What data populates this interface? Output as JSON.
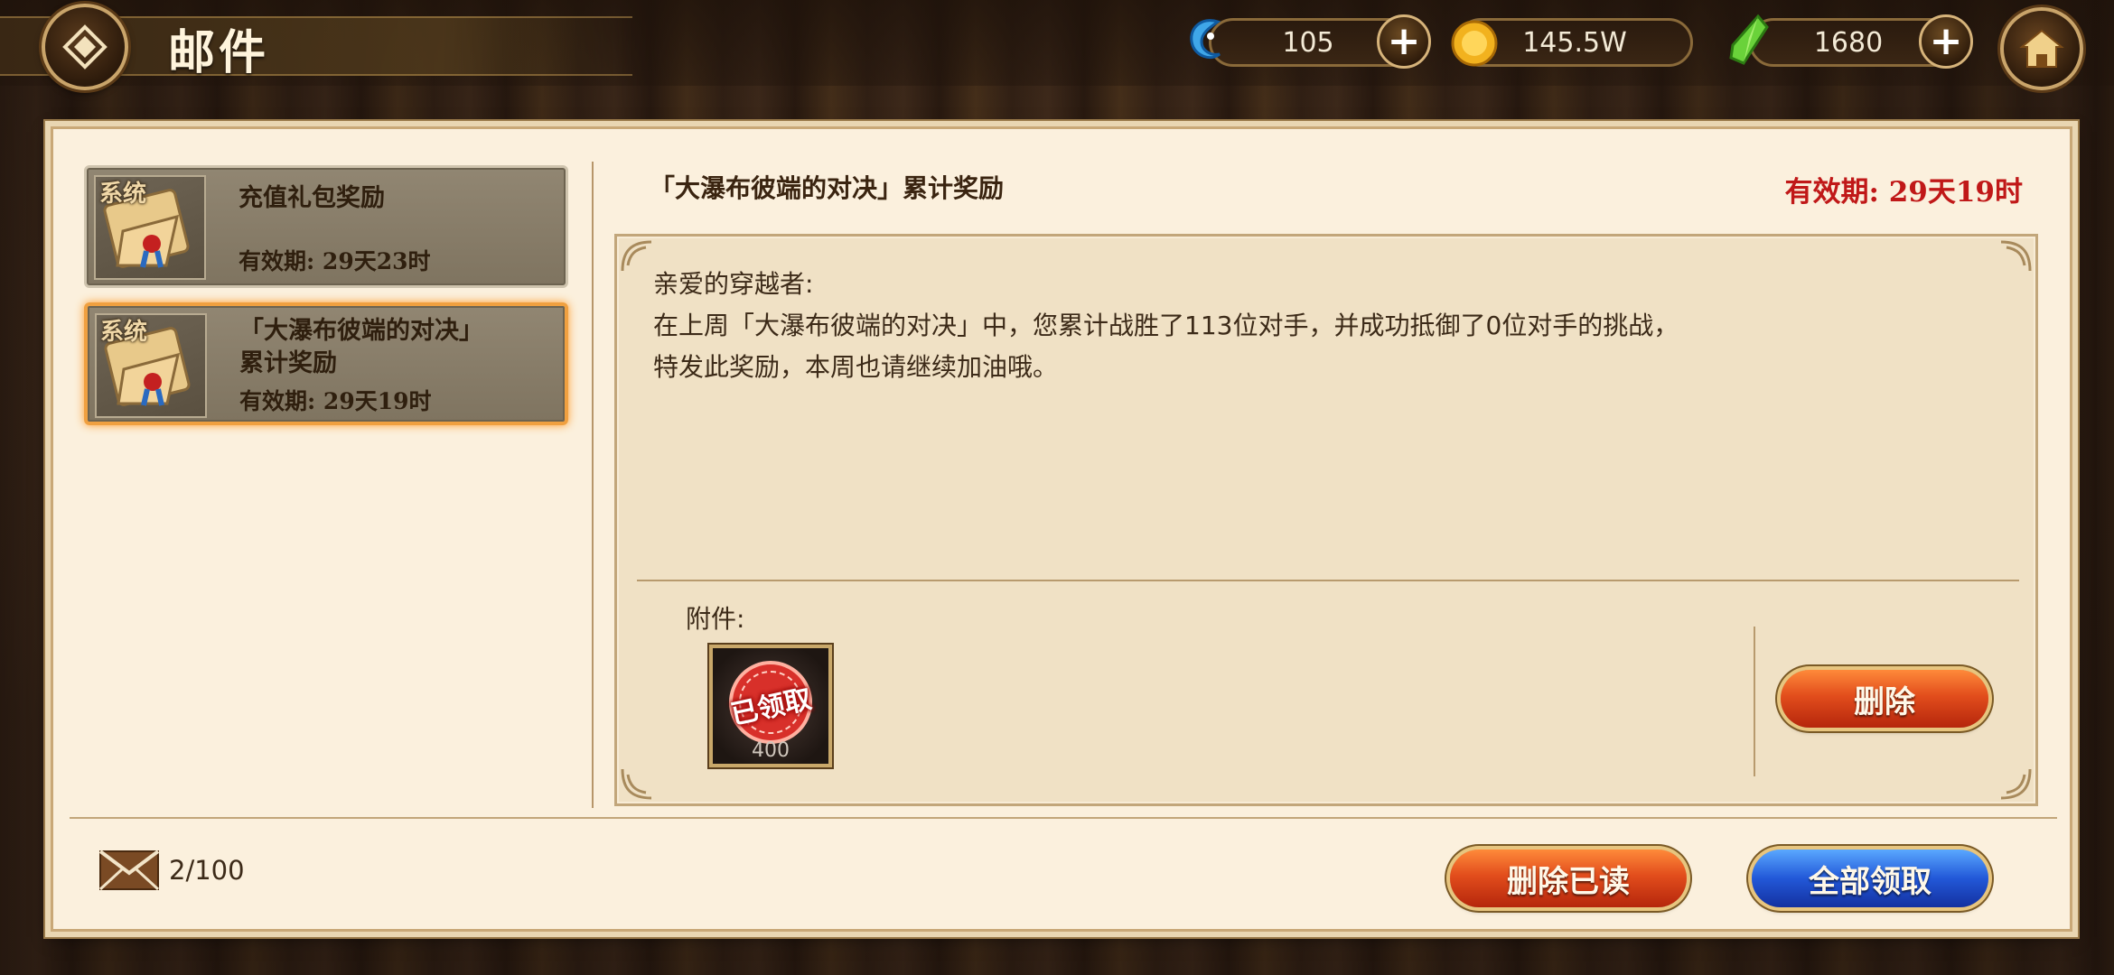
{
  "header": {
    "title": "邮件",
    "back_icon": "diamond-back-icon",
    "home_icon": "home-icon"
  },
  "currencies": [
    {
      "name": "blue-fish",
      "icon": "blue-fish-icon",
      "value": "105",
      "has_plus": true
    },
    {
      "name": "gold",
      "icon": "gold-coin-icon",
      "value": "145.5W",
      "has_plus": false
    },
    {
      "name": "green-crystal",
      "icon": "green-crystal-icon",
      "value": "1680",
      "has_plus": true
    }
  ],
  "mail_list": [
    {
      "tag": "系统",
      "title": "充值礼包奖励",
      "expiry": "有效期:  29天23时",
      "selected": false
    },
    {
      "tag": "系统",
      "title": "「大瀑布彼端的对决」累计奖励",
      "expiry": "有效期:  29天19时",
      "selected": true
    }
  ],
  "detail": {
    "title": "「大瀑布彼端的对决」累计奖励",
    "expiry": "有效期:  29天19时",
    "greeting": "亲爱的穿越者:",
    "body": "在上周「大瀑布彼端的对决」中，您累计战胜了113位对手，并成功抵御了0位对手的挑战，特发此奖励，本周也请继续加油哦。",
    "attachment_label": "附件:",
    "attachment": {
      "stamp": "已领取",
      "count": "400"
    },
    "delete_label": "删除"
  },
  "footer": {
    "mail_count": "2/100",
    "delete_read_label": "删除已读",
    "claim_all_label": "全部领取"
  },
  "colors": {
    "panel_bg": "#fbf0dd",
    "expiry_red": "#c01818",
    "selected_border": "#f0a040",
    "btn_red": "#e24d1c",
    "btn_blue": "#2258d8"
  }
}
